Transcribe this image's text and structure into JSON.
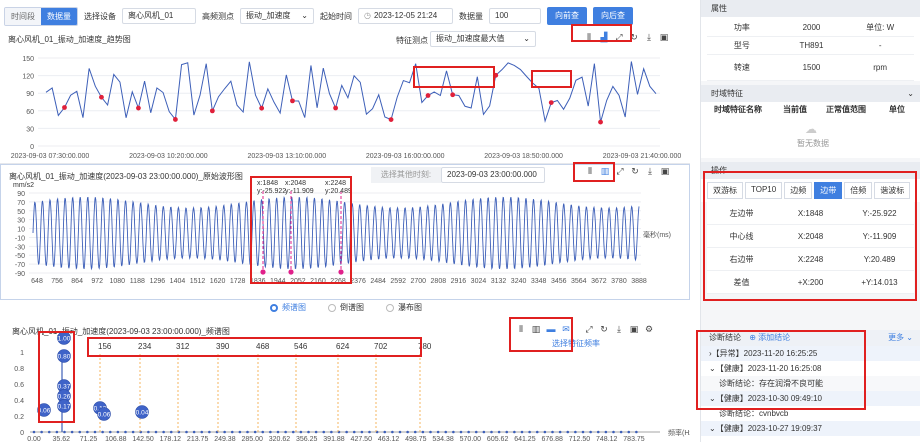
{
  "toolbar": {
    "mode_options": [
      "时间段",
      "数据量"
    ],
    "device_label": "选择设备",
    "device_value": "离心风机_01",
    "point_label": "高频测点",
    "point_value": "振动_加速度",
    "start_label": "起始时间",
    "start_value": "2023-12-05 21:24",
    "count_label": "数据量",
    "count_value": "100",
    "prev_btn": "向前查",
    "next_btn": "向后查"
  },
  "trend": {
    "title": "离心风机_01_振动_加速度_趋势图",
    "feature_label": "特征测点",
    "feature_value": "振动_加速度最大值",
    "yticks": [
      "150",
      "120",
      "90",
      "60",
      "30",
      "0"
    ],
    "xticks": [
      "2023-09-03 07:30:00.000",
      "2023-09-03 10:20:00.000",
      "2023-09-03 13:10:00.000",
      "2023-09-03 16:00:00.000",
      "2023-09-03 18:50:00.000",
      "2023-09-03 21:40:00.000"
    ]
  },
  "wave": {
    "title": "离心风机_01_振动_加速度(2023-09-03 23:00:00.000)_原始波形图",
    "unit": "mm/s2",
    "other_time_label": "选择其他时刻:",
    "other_time_value": "2023-09-03 23:00:00.000",
    "yticks": [
      "90",
      "70",
      "50",
      "30",
      "10",
      "-10",
      "-30",
      "-50",
      "-70",
      "-90"
    ],
    "xticks": [
      "648",
      "756",
      "864",
      "972",
      "1080",
      "1188",
      "1296",
      "1404",
      "1512",
      "1620",
      "1728",
      "1836",
      "1944",
      "2052",
      "2160",
      "2268",
      "2376",
      "2484",
      "2592",
      "2700",
      "2808",
      "2916",
      "3024",
      "3132",
      "3240",
      "3348",
      "3456",
      "3564",
      "3672",
      "3780",
      "3888"
    ],
    "xunit": "毫秒(ms)",
    "cursors": [
      {
        "x_label": "x:1848",
        "y_label": "y:-25.922"
      },
      {
        "x_label": "x:2048",
        "y_label": "y:-11.909"
      },
      {
        "x_label": "x:2248",
        "y_label": "y:20.489"
      }
    ]
  },
  "view_switch": {
    "options": [
      "频谱图",
      "倒谱图",
      "瀑布图"
    ],
    "selected": "频谱图"
  },
  "spectrum": {
    "title": "离心风机_01_振动_加速度(2023-09-03 23:00:00.000)_频谱图",
    "select_feature": "选择特征频率",
    "yticks": [
      "1",
      "0.8",
      "0.6",
      "0.4",
      "0.2",
      "0"
    ],
    "xticks": [
      "0.00",
      "35.62",
      "71.25",
      "106.88",
      "142.50",
      "178.12",
      "213.75",
      "249.38",
      "285.00",
      "320.62",
      "356.25",
      "391.88",
      "427.50",
      "463.12",
      "498.75",
      "534.38",
      "570.00",
      "605.62",
      "641.25",
      "676.88",
      "712.50",
      "748.12",
      "783.75"
    ],
    "xunit": "频率(Hz)",
    "harmonics": [
      "156",
      "234",
      "312",
      "390",
      "468",
      "546",
      "624",
      "702",
      "780"
    ],
    "pins": [
      "1.00",
      "0.80",
      "0.37",
      "0.26",
      "0.17",
      "0.06",
      "0.10",
      "0.06",
      "0.04"
    ]
  },
  "attributes": {
    "header": "属性",
    "rows": [
      {
        "name": "功率",
        "value": "2000",
        "extra": "单位: W"
      },
      {
        "name": "型号",
        "value": "TH891",
        "extra": "-"
      },
      {
        "name": "转速",
        "value": "1500",
        "extra": "rpm"
      }
    ]
  },
  "time_features": {
    "header": "时域特征",
    "columns": [
      "时域特征名称",
      "当前值",
      "正常值范围",
      "单位"
    ],
    "empty": "暂无数据"
  },
  "operation": {
    "header": "操作",
    "tabs": [
      "双游标",
      "TOP10",
      "边频",
      "边带",
      "倍频",
      "谐波标"
    ],
    "active_tab": "边带",
    "rows": [
      {
        "name": "左边带",
        "x": "X:1848",
        "y": "Y:-25.922"
      },
      {
        "name": "中心线",
        "x": "X:2048",
        "y": "Y:-11.909"
      },
      {
        "name": "右边带",
        "x": "X:2248",
        "y": "Y:20.489"
      },
      {
        "name": "差值",
        "x": "+X:200",
        "y": "+Y:14.013"
      }
    ]
  },
  "diagnosis": {
    "header": "诊断结论",
    "add": "添加结论",
    "more": "更多",
    "items": [
      {
        "tag": "【异常】",
        "time": "2023-11-20 16:25:25"
      },
      {
        "tag": "【健康】",
        "time": "2023-11-20 16:25:08"
      },
      {
        "detail": "诊断结论：存在润滑不良可能"
      },
      {
        "tag": "【健康】",
        "time": "2023-10-30 09:49:10"
      },
      {
        "detail": "诊断结论：cvnbvcb"
      },
      {
        "tag": "【健康】",
        "time": "2023-10-27 19:09:37"
      }
    ]
  },
  "colors": {
    "accent": "#3f7fe0",
    "series": "#3d5fb8",
    "marker": "#e0203a",
    "highlight": "#e02020",
    "cursor": "#e0208a",
    "harmonic": "#f3a53a"
  }
}
